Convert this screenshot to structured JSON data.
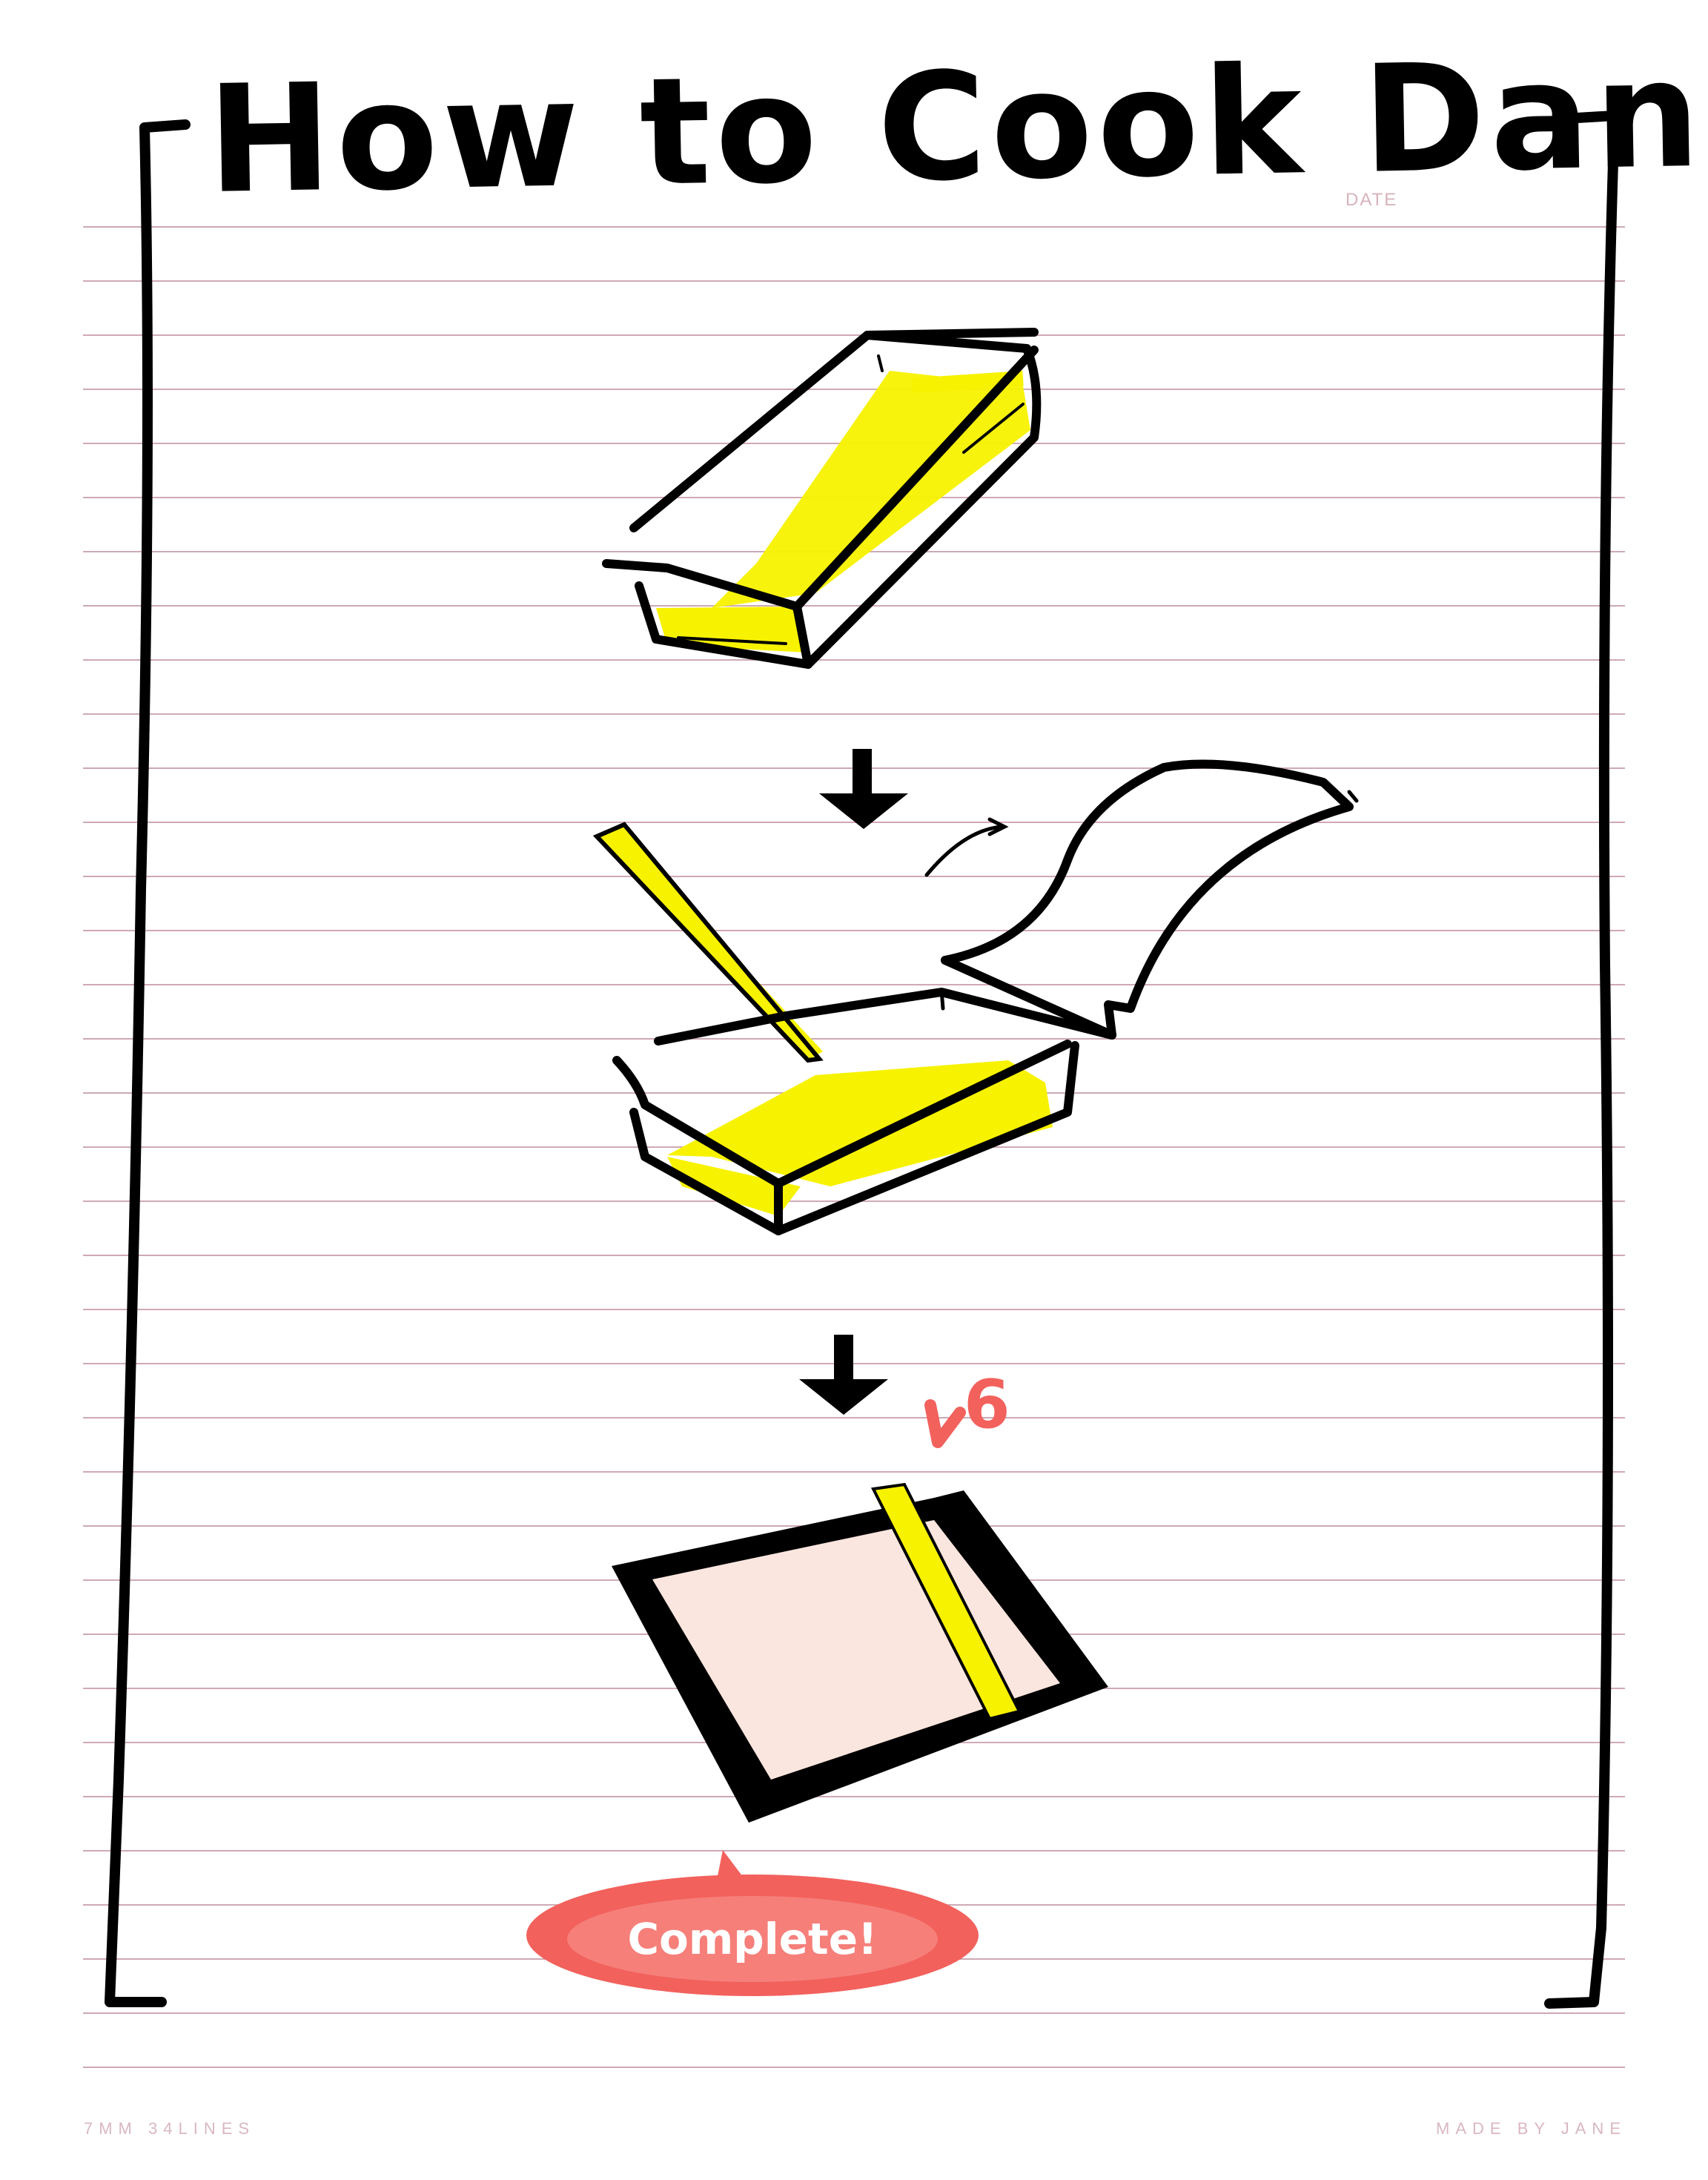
{
  "title": "How to Cook Danmooji",
  "date_label": "DATE",
  "footer": {
    "left": "7MM 34LINES",
    "right": "MADE BY JANE"
  },
  "steps": [
    {
      "name": "tray-with-yellow-filling"
    },
    {
      "name": "pour-yellow-strip-into-tray"
    },
    {
      "name": "yellow-strip-on-rice-sheet"
    }
  ],
  "annotations": {
    "count_mark": "6",
    "bubble_text": "Complete!"
  },
  "colors": {
    "ink": "#000000",
    "highlight": "#f7f200",
    "accent": "#f2615c",
    "rice": "#fbe6df",
    "rule_line": "#cfa9b4",
    "footer_text": "#d9b7c0"
  }
}
